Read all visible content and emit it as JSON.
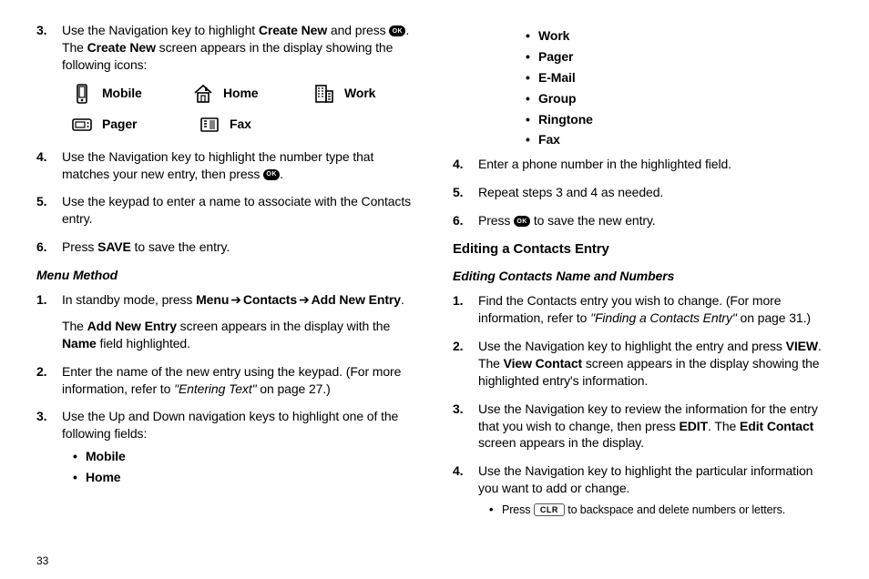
{
  "leftColumn": {
    "s3_a": "Use the Navigation key to highlight ",
    "s3_b": "Create New",
    "s3_c": " and press ",
    "s3_d": ". The ",
    "s3_e": "Create New",
    "s3_f": " screen appears in the display showing the following icons:",
    "iconLabels": {
      "mobile": "Mobile",
      "home": "Home",
      "work": "Work",
      "pager": "Pager",
      "fax": "Fax"
    },
    "s4_a": "Use the Navigation key to highlight the number type that matches your new entry, then press ",
    "s4_b": ".",
    "s5": "Use the keypad to enter a name to associate with the Contacts entry.",
    "s6_a": "Press ",
    "s6_b": "SAVE",
    "s6_c": " to save the entry.",
    "h_menuMethod": "Menu Method",
    "m1_a": "In standby mode, press ",
    "m1_b": "Menu",
    "m1_c": "Contacts",
    "m1_d": "Add New Entry",
    "m1_e": ".",
    "m1_f": "The ",
    "m1_g": "Add New Entry",
    "m1_h": " screen appears in the display with the ",
    "m1_i": "Name",
    "m1_j": " field highlighted.",
    "m2_a": "Enter the name of the new entry using the keypad. (For more information, refer to ",
    "m2_b": "\"Entering Text\" ",
    "m2_c": " on page 27.)",
    "m3": "Use the Up and Down navigation keys to highlight one of the following fields:",
    "fieldsA": [
      "Mobile",
      "Home"
    ]
  },
  "rightColumn": {
    "fieldsB": [
      "Work",
      "Pager",
      "E-Mail",
      "Group",
      "Ringtone",
      "Fax"
    ],
    "s4": "Enter a phone number in the highlighted field.",
    "s5": "Repeat steps 3 and 4 as needed.",
    "s6_a": "Press ",
    "s6_b": " to save the new entry.",
    "h_edit": "Editing a Contacts Entry",
    "h_editSub": "Editing Contacts Name and Numbers",
    "e1_a": "Find the Contacts entry you wish to change. (For more information, refer to ",
    "e1_b": "\"Finding a Contacts Entry\" ",
    "e1_c": " on page 31.)",
    "e2_a": "Use the Navigation key to highlight the entry and press ",
    "e2_b": "VIEW",
    "e2_c": ". The ",
    "e2_d": "View Contact",
    "e2_e": " screen appears in the display showing the highlighted entry's information.",
    "e3_a": "Use the Navigation key to review the information for the entry that you wish to change, then press ",
    "e3_b": "EDIT",
    "e3_c": ". The ",
    "e3_d": "Edit Contact",
    "e3_e": " screen appears in the display.",
    "e4": "Use the Navigation key to highlight the particular information you want to add or change.",
    "e4_sub_a": "Press ",
    "e4_sub_b": " to backspace and delete numbers or letters.",
    "clr": "CLR"
  },
  "arrow": "➔",
  "ok": "OK",
  "pageNumber": "33"
}
